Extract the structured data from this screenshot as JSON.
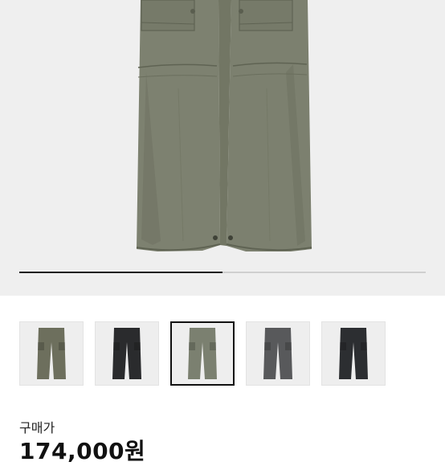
{
  "product": {
    "image_progress": 0.5,
    "color_options": [
      {
        "color": "#6d6f5d",
        "selected": false
      },
      {
        "color": "#2a2b2d",
        "selected": false
      },
      {
        "color": "#7b8070",
        "selected": true
      },
      {
        "color": "#58595b",
        "selected": false
      },
      {
        "color": "#2c2e31",
        "selected": false
      }
    ],
    "price_label": "구매가",
    "price_value": "174,000원"
  },
  "colors": {
    "hero_background": "#efefef",
    "pants_main": "#7d8170",
    "pants_shadow": "#6a6e5e",
    "accent_dark": "#111111"
  }
}
